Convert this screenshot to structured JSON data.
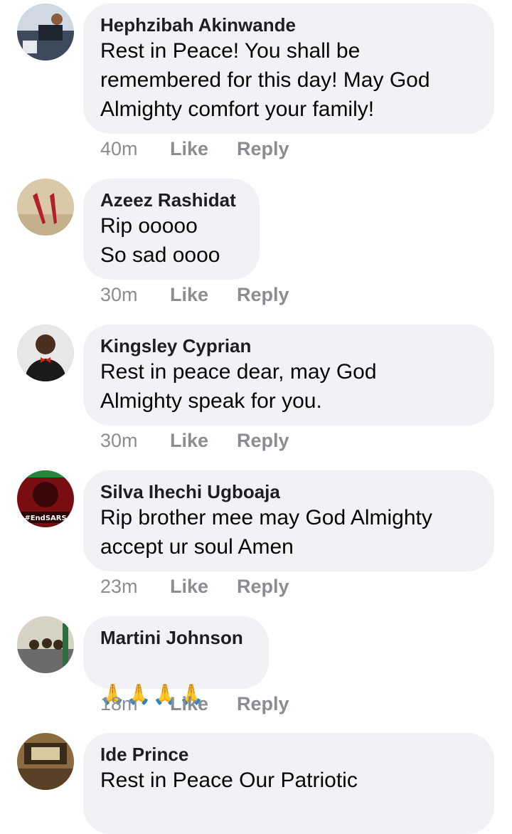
{
  "comments": [
    {
      "author": "Hephzibah Akinwande",
      "text": "Rest in Peace! You shall be\nremembered for this day! May God\nAlmighty comfort your family!",
      "time": "40m",
      "like_label": "Like",
      "reply_label": "Reply",
      "avatar_colors": [
        "#cfd8e3",
        "#3d4a5c"
      ]
    },
    {
      "author": "Azeez Rashidat",
      "text": "Rip ooooo\nSo sad oooo",
      "time": "30m",
      "like_label": "Like",
      "reply_label": "Reply",
      "avatar_colors": [
        "#d9c9a8",
        "#b3202a"
      ]
    },
    {
      "author": "Kingsley Cyprian",
      "text": "Rest in peace dear, may God\nAlmighty speak for you.",
      "time": "30m",
      "like_label": "Like",
      "reply_label": "Reply",
      "avatar_colors": [
        "#e8e8e8",
        "#1a1a1a"
      ]
    },
    {
      "author": "Silva Ihechi Ugboaja",
      "text": "Rip brother mee may God Almighty\naccept ur soul Amen",
      "time": "23m",
      "like_label": "Like",
      "reply_label": "Reply",
      "avatar_badge": "#EndSARS",
      "avatar_colors": [
        "#7a0d12",
        "#1f8a3a"
      ]
    },
    {
      "author": "Martini Johnson",
      "text": "🙏🙏🙏🙏",
      "time": "18m",
      "like_label": "Like",
      "reply_label": "Reply",
      "avatar_colors": [
        "#d6d2c4",
        "#2c6e3f"
      ]
    },
    {
      "author": "Ide Prince",
      "text": "Rest in Peace Our Patriotic",
      "time": "",
      "like_label": "",
      "reply_label": "",
      "avatar_colors": [
        "#8b6a3e",
        "#3a2a1a"
      ]
    }
  ]
}
